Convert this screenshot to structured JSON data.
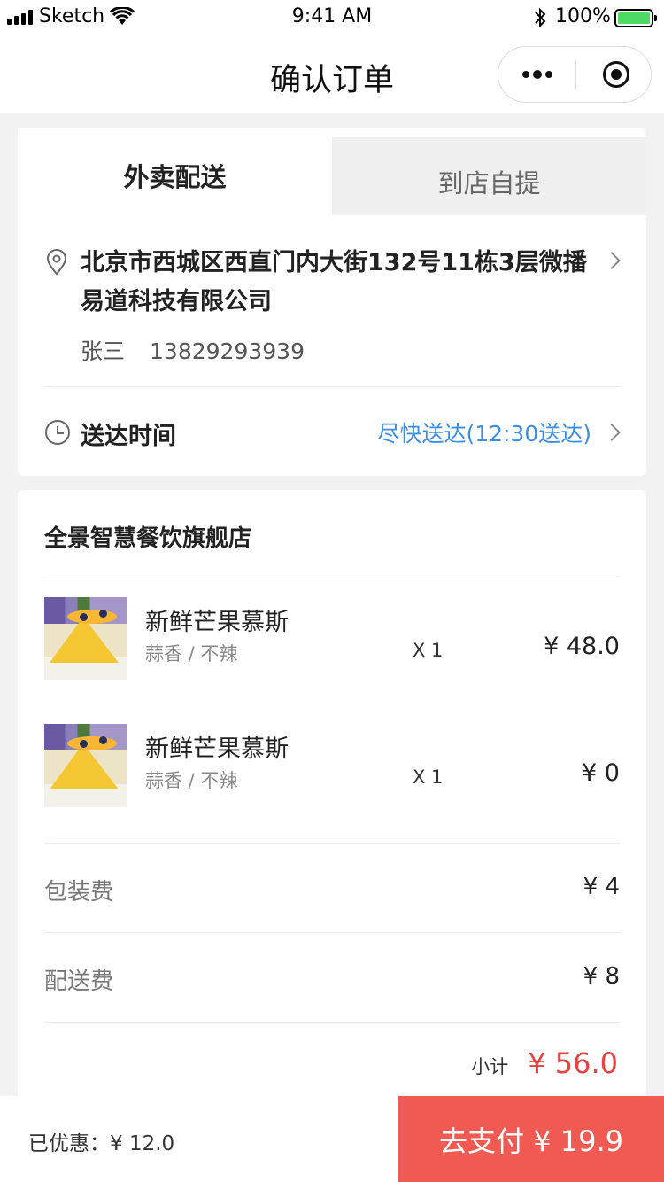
{
  "status_bar": {
    "carrier": "Sketch",
    "time": "9:41 AM",
    "battery": "100%"
  },
  "nav": {
    "title": "确认订单"
  },
  "delivery": {
    "tabs": [
      {
        "label": "外卖配送",
        "active": true
      },
      {
        "label": "到店自提",
        "active": false
      }
    ],
    "address": "北京市西城区西直门内大街132号11栋3层微播易道科技有限公司",
    "contact_name": "张三",
    "contact_phone": "13829293939",
    "time_label": "送达时间",
    "time_value": "尽快送达(12:30送达)"
  },
  "order": {
    "shop_name": "全景智慧餐饮旗舰店",
    "items": [
      {
        "name": "新鲜芒果慕斯",
        "spec": "蒜香 / 不辣",
        "qty": "X 1",
        "price": "¥ 48.0"
      },
      {
        "name": "新鲜芒果慕斯",
        "spec": "蒜香 / 不辣",
        "qty": "X 1",
        "price": "¥ 0"
      }
    ],
    "fees": [
      {
        "label": "包装费",
        "value": "¥ 4"
      },
      {
        "label": "配送费",
        "value": "¥ 8"
      }
    ],
    "subtotal_label": "小计",
    "subtotal_value": "¥ 56.0"
  },
  "footer": {
    "discount": "已优惠：¥ 12.0",
    "pay_label": "去支付 ¥ 19.9"
  },
  "colors": {
    "accent_red": "#f05a53",
    "price_red": "#e64340",
    "link_blue": "#3a8ee6",
    "battery_green": "#4cd964"
  }
}
